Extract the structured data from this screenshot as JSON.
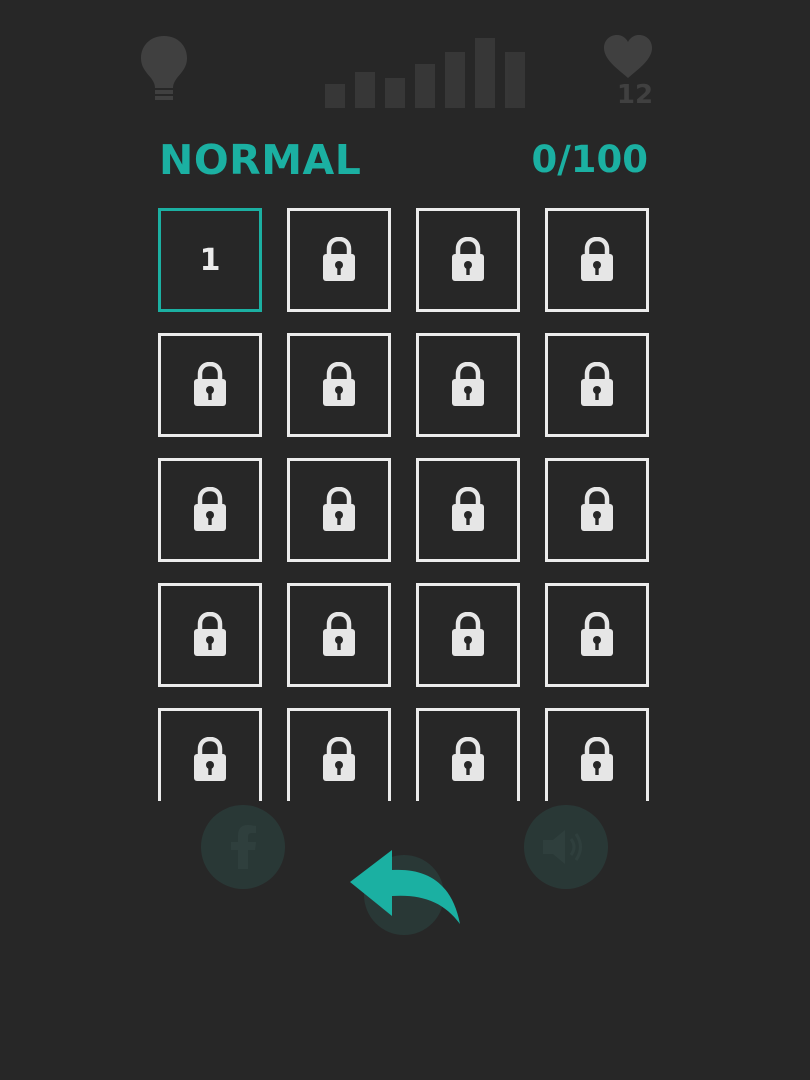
{
  "header": {
    "mode_title": "NORMAL",
    "progress": "0/100"
  },
  "background": {
    "lives_count": "12"
  },
  "levels": {
    "tiles": [
      {
        "state": "unlocked",
        "label": "1"
      },
      {
        "state": "locked"
      },
      {
        "state": "locked"
      },
      {
        "state": "locked"
      },
      {
        "state": "locked"
      },
      {
        "state": "locked"
      },
      {
        "state": "locked"
      },
      {
        "state": "locked"
      },
      {
        "state": "locked"
      },
      {
        "state": "locked"
      },
      {
        "state": "locked"
      },
      {
        "state": "locked"
      },
      {
        "state": "locked"
      },
      {
        "state": "locked"
      },
      {
        "state": "locked"
      },
      {
        "state": "locked"
      },
      {
        "state": "locked"
      },
      {
        "state": "locked"
      },
      {
        "state": "locked"
      },
      {
        "state": "locked"
      }
    ]
  },
  "icons": {
    "locked_tile": "lock-icon",
    "back": "back-arrow-icon",
    "hint": "lightbulb-icon",
    "lives": "heart-icon",
    "facebook": "facebook-icon",
    "sound": "speaker-icon"
  },
  "colors": {
    "background": "#272727",
    "accent": "#1bb0a2",
    "tile_border": "#ececec",
    "lock": "#e6e6e6"
  }
}
